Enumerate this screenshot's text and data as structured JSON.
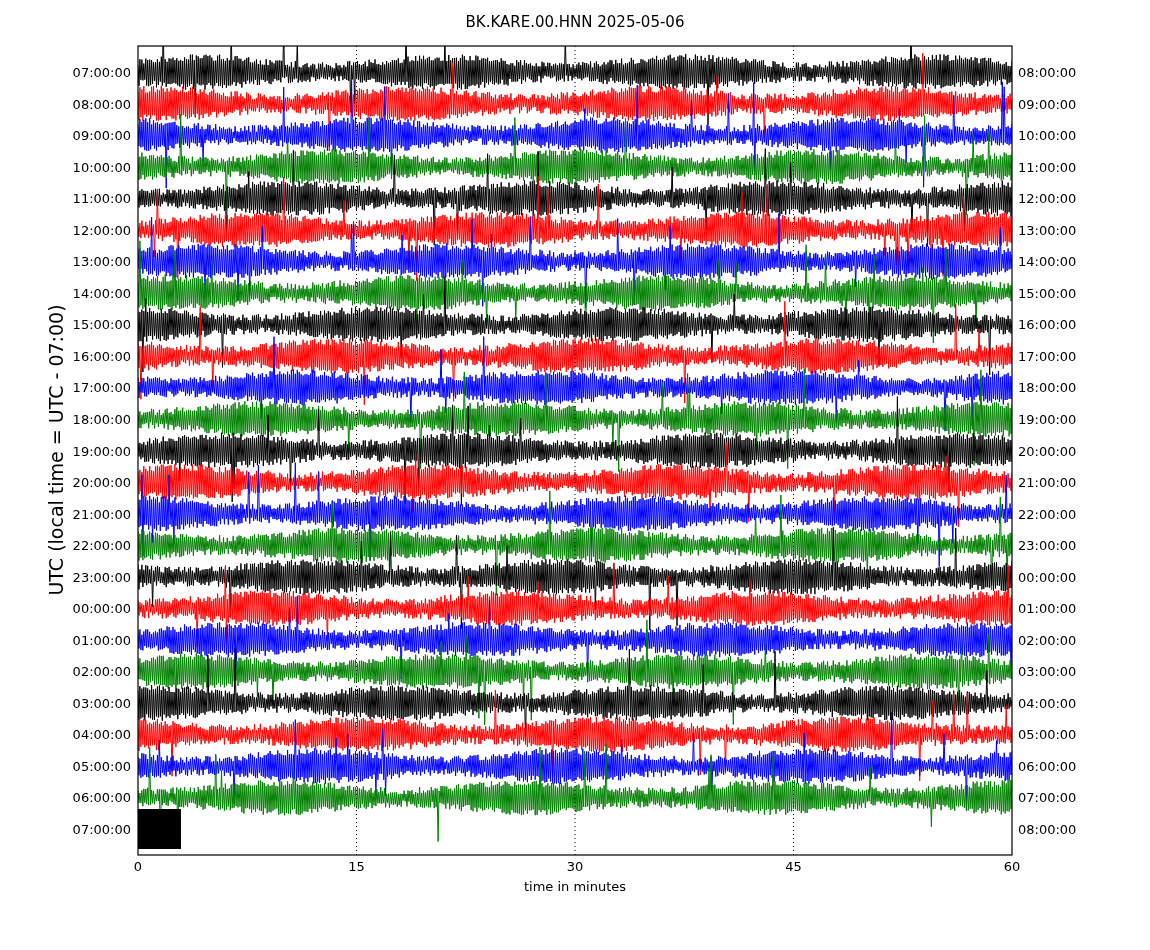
{
  "title": "BK.KARE.00.HNN 2025-05-06",
  "y_axis_label": "UTC (local time = UTC - 07:00)",
  "x_axis_label": "time in minutes",
  "left_ticks": [
    "07:00:00",
    "08:00:00",
    "09:00:00",
    "10:00:00",
    "11:00:00",
    "12:00:00",
    "13:00:00",
    "14:00:00",
    "15:00:00",
    "16:00:00",
    "17:00:00",
    "18:00:00",
    "19:00:00",
    "20:00:00",
    "21:00:00",
    "22:00:00",
    "23:00:00",
    "00:00:00",
    "01:00:00",
    "02:00:00",
    "03:00:00",
    "04:00:00",
    "05:00:00",
    "06:00:00",
    "07:00:00"
  ],
  "right_ticks": [
    "08:00:00",
    "09:00:00",
    "10:00:00",
    "11:00:00",
    "12:00:00",
    "13:00:00",
    "14:00:00",
    "15:00:00",
    "16:00:00",
    "17:00:00",
    "18:00:00",
    "19:00:00",
    "20:00:00",
    "21:00:00",
    "22:00:00",
    "23:00:00",
    "00:00:00",
    "01:00:00",
    "02:00:00",
    "03:00:00",
    "04:00:00",
    "05:00:00",
    "06:00:00",
    "07:00:00",
    "08:00:00"
  ],
  "x_ticks": [
    "0",
    "15",
    "30",
    "45",
    "60"
  ]
}
